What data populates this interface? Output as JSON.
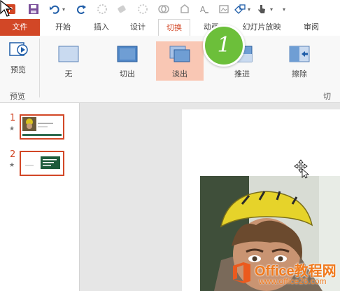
{
  "tabs": {
    "file": "文件",
    "home": "开始",
    "insert": "插入",
    "design": "设计",
    "transitions": "切换",
    "animations": "动画",
    "slideshow": "幻灯片放映",
    "review": "审阅"
  },
  "ribbon": {
    "preview_button": "预览",
    "preview_group": "预览",
    "transitions_group_partial": "切",
    "transitions": [
      {
        "label": "无",
        "icon": "transition-none-icon"
      },
      {
        "label": "切出",
        "icon": "transition-cut-icon"
      },
      {
        "label": "淡出",
        "icon": "transition-fade-icon",
        "selected": true
      },
      {
        "label": "推进",
        "icon": "transition-push-icon"
      },
      {
        "label": "擦除",
        "icon": "transition-wipe-icon"
      }
    ]
  },
  "slides": [
    {
      "number": "1",
      "star": "★"
    },
    {
      "number": "2",
      "star": "★"
    }
  ],
  "step_badge": "1",
  "watermark": {
    "brand": "Office教程网",
    "url": "www.office26.com"
  },
  "colors": {
    "accent": "#d24726",
    "selected_fill": "#f9c7b4",
    "badge": "#6cbf3a",
    "watermark": "#f07a1e"
  }
}
